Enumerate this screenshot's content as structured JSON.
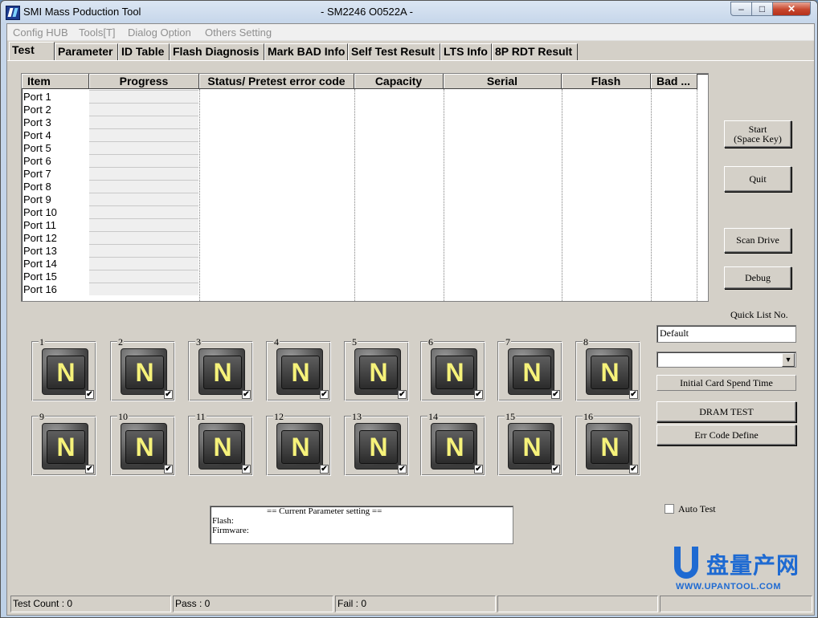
{
  "window": {
    "title": "SMI Mass Poduction Tool",
    "center_title": "- SM2246 O0522A -",
    "min_glyph": "–",
    "max_glyph": "□",
    "close_glyph": "✕"
  },
  "menu": [
    "Config HUB",
    "Tools[T]",
    "Dialog Option",
    "Others Setting"
  ],
  "tabs": [
    "Test",
    "Parameter",
    "ID Table",
    "Flash Diagnosis",
    "Mark BAD Info",
    "Self Test Result",
    "LTS Info",
    "8P RDT Result"
  ],
  "active_tab": "Test",
  "grid": {
    "columns": [
      "Item",
      "Progress",
      "Status/ Pretest error code",
      "Capacity",
      "Serial",
      "Flash",
      "Bad ..."
    ],
    "rows": [
      "Port 1",
      "Port 2",
      "Port 3",
      "Port 4",
      "Port 5",
      "Port 6",
      "Port 7",
      "Port 8",
      "Port 9",
      "Port 10",
      "Port 11",
      "Port 12",
      "Port 13",
      "Port 14",
      "Port 15",
      "Port 16"
    ]
  },
  "buttons": {
    "start_line1": "Start",
    "start_line2": "(Space Key)",
    "quit": "Quit",
    "scan_drive": "Scan Drive",
    "debug": "Debug",
    "dram_test": "DRAM TEST",
    "err_code_define": "Err Code Define"
  },
  "quick_list": {
    "label": "Quick List No.",
    "value": "Default",
    "dropdown_value": ""
  },
  "initial_card_label": "Initial Card Spend Time",
  "ports": {
    "numbers": [
      "1",
      "2",
      "3",
      "4",
      "5",
      "6",
      "7",
      "8",
      "9",
      "10",
      "11",
      "12",
      "13",
      "14",
      "15",
      "16"
    ],
    "status_letter": "N",
    "checked_glyph": "✔"
  },
  "param_box": {
    "header": "== Current Parameter setting ==",
    "flash": "Flash:",
    "firmware": "Firmware:"
  },
  "auto_test_label": "Auto Test",
  "statusbar": {
    "test_count": "Test Count : 0",
    "pass": "Pass : 0",
    "fail": "Fail : 0"
  },
  "watermark": {
    "cn": "盘量产网",
    "url": "WWW.UPANTOOL.COM"
  }
}
